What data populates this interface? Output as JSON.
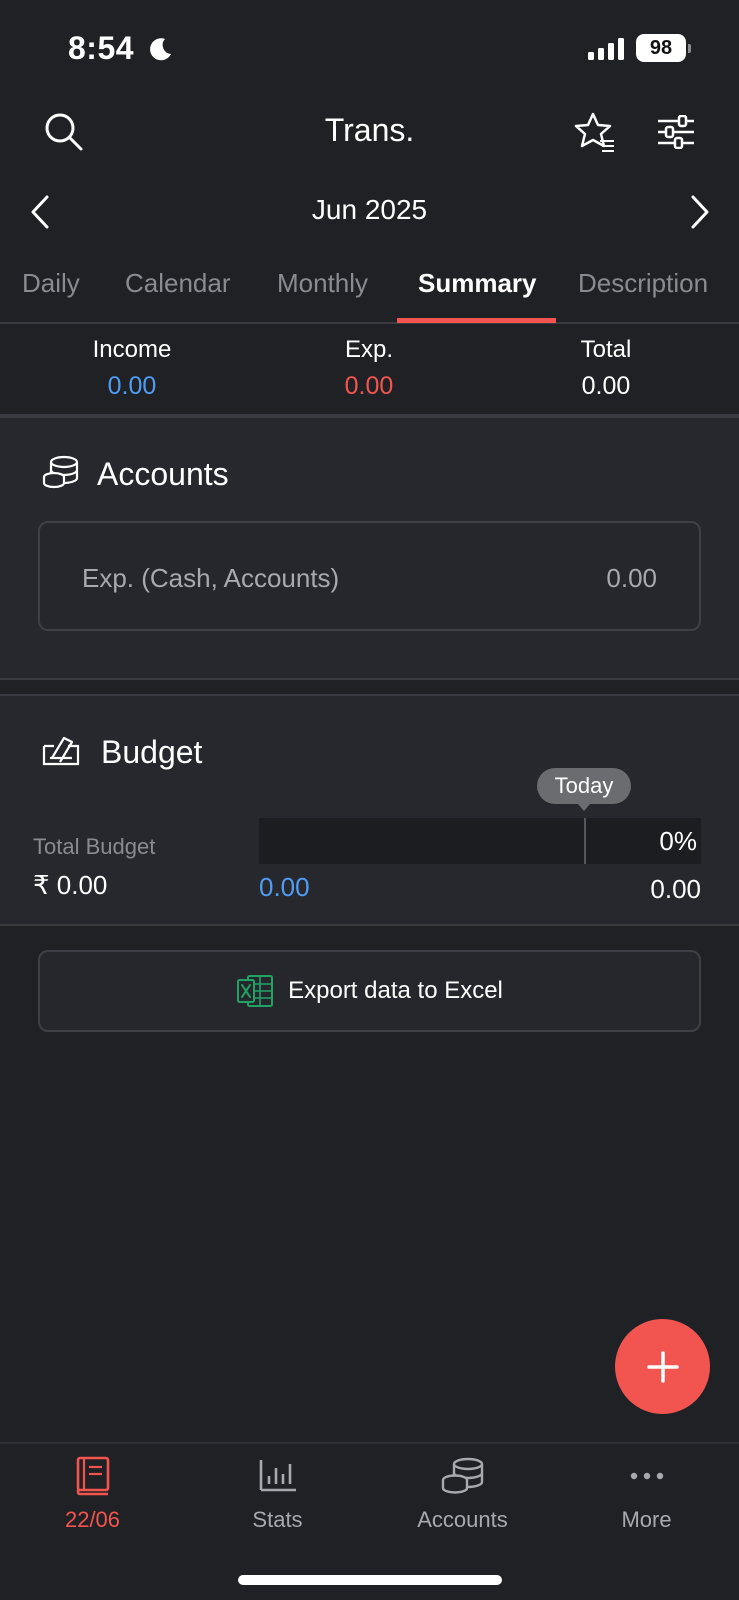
{
  "status_bar": {
    "time": "8:54",
    "battery": "98"
  },
  "header": {
    "title": "Trans."
  },
  "month_nav": {
    "label": "Jun 2025"
  },
  "tabs": [
    {
      "label": "Daily"
    },
    {
      "label": "Calendar"
    },
    {
      "label": "Monthly"
    },
    {
      "label": "Summary",
      "active": true
    },
    {
      "label": "Description"
    }
  ],
  "totals": {
    "income_label": "Income",
    "income_value": "0.00",
    "exp_label": "Exp.",
    "exp_value": "0.00",
    "total_label": "Total",
    "total_value": "0.00"
  },
  "accounts_section": {
    "title": "Accounts",
    "row_label": "Exp. (Cash, Accounts)",
    "row_value": "0.00"
  },
  "budget_section": {
    "title": "Budget",
    "today_label": "Today",
    "total_budget_label": "Total Budget",
    "total_budget_amount": "₹ 0.00",
    "percent": "0%",
    "used_value": "0.00",
    "remaining_value": "0.00",
    "progress_fraction": 0
  },
  "export_button": {
    "label": "Export data to Excel"
  },
  "bottom_nav": [
    {
      "label": "22/06",
      "active": true
    },
    {
      "label": "Stats"
    },
    {
      "label": "Accounts"
    },
    {
      "label": "More"
    }
  ],
  "colors": {
    "background": "#202125",
    "accent": "#f2554f",
    "income": "#4f9cf5",
    "expense": "#f2554f",
    "excel_green": "#21a366"
  }
}
